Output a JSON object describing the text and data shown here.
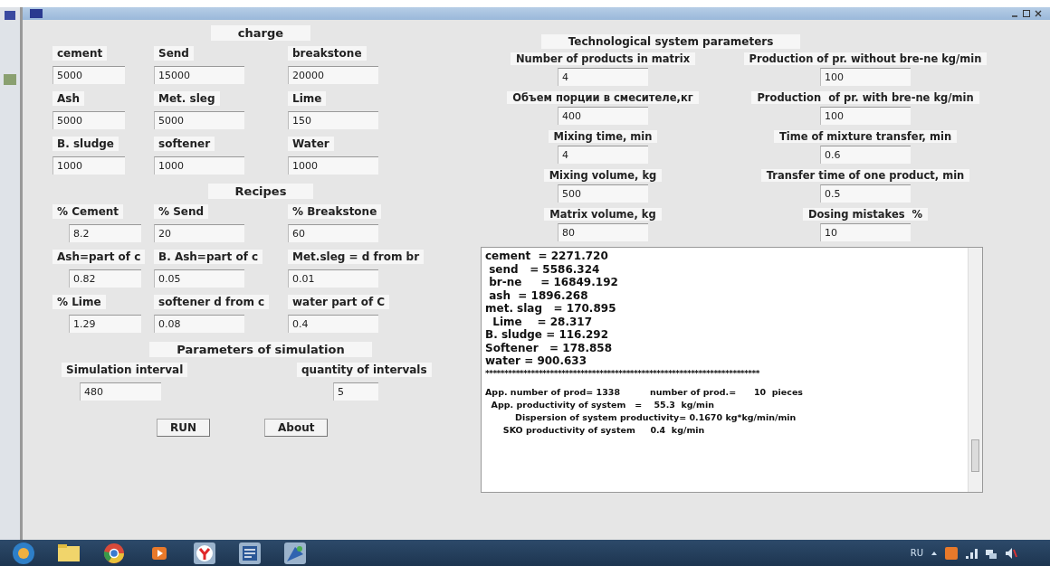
{
  "charge": {
    "title": "charge",
    "fields": [
      {
        "label": "cement",
        "value": "5000"
      },
      {
        "label": "Send",
        "value": "15000"
      },
      {
        "label": "breakstone",
        "value": "20000"
      },
      {
        "label": "Ash",
        "value": "5000"
      },
      {
        "label": "Met. sleg",
        "value": "5000"
      },
      {
        "label": "Lime",
        "value": "150"
      },
      {
        "label": "B. sludge",
        "value": "1000"
      },
      {
        "label": "softener",
        "value": "1000"
      },
      {
        "label": "Water",
        "value": "1000"
      }
    ]
  },
  "recipes": {
    "title": "Recipes",
    "fields": [
      {
        "label": "% Cement",
        "value": "8.2"
      },
      {
        "label": "% Send",
        "value": "20"
      },
      {
        "label": "% Breakstone",
        "value": "60"
      },
      {
        "label": "Ash=part of c",
        "value": "0.82"
      },
      {
        "label": "B. Ash=part of c",
        "value": "0.05"
      },
      {
        "label": "Met.sleg = d from br",
        "value": "0.01"
      },
      {
        "label": "% Lime",
        "value": "1.29"
      },
      {
        "label": "softener d from c",
        "value": "0.08"
      },
      {
        "label": "water part of C",
        "value": "0.4"
      }
    ]
  },
  "simulation": {
    "title": "Parameters of simulation",
    "fields": [
      {
        "label": "Simulation interval",
        "value": "480"
      },
      {
        "label": "quantity of intervals",
        "value": "5"
      }
    ]
  },
  "buttons": [
    "RUN",
    "About"
  ],
  "system_parameters": {
    "title": "Technological system parameters",
    "fields": [
      {
        "label": "Number of products in matrix",
        "value": "4"
      },
      {
        "label": "Production of pr. without bre-ne kg/min",
        "value": "100"
      },
      {
        "label": "Объем порции в смесителе,кг",
        "value": "400"
      },
      {
        "label": "Production  of pr. with bre-ne kg/min",
        "value": "100"
      },
      {
        "label": "Mixing time, min",
        "value": "4"
      },
      {
        "label": "Time of mixture transfer, min",
        "value": "0.6"
      },
      {
        "label": "Mixing volume, kg",
        "value": "500"
      },
      {
        "label": "Transfer time of one product, min",
        "value": "0.5"
      },
      {
        "label": "Matrix volume, kg",
        "value": "80"
      },
      {
        "label": "Dosing mistakes  %",
        "value": "10"
      }
    ]
  },
  "output": {
    "lines": [
      {
        "kind": "result",
        "text": "cement  = 2271.720"
      },
      {
        "kind": "result",
        "text": " send   = 5586.324"
      },
      {
        "kind": "result",
        "text": " br-ne     = 16849.192"
      },
      {
        "kind": "result",
        "text": " ash  = 1896.268"
      },
      {
        "kind": "result",
        "text": "met. slag   = 170.895"
      },
      {
        "kind": "result",
        "text": "  Lime    = 28.317"
      },
      {
        "kind": "result",
        "text": "B. sludge = 116.292"
      },
      {
        "kind": "result",
        "text": "Softener   = 178.858"
      },
      {
        "kind": "result",
        "text": "water = 900.633"
      },
      {
        "kind": "separator",
        "text": "************************************************************************"
      },
      {
        "kind": "summary",
        "text": "App. number of prod= 1338          number of prod.=      10  pieces"
      },
      {
        "kind": "summary",
        "text": "  App. productivity of system   =    55.3  kg/min"
      },
      {
        "kind": "summary",
        "text": "          Dispersion of system productivity= 0.1670 kg*kg/min/min"
      },
      {
        "kind": "summary",
        "text": "      SKO productivity of system     0.4  kg/min"
      }
    ]
  },
  "taskbar": {
    "language": "RU"
  }
}
